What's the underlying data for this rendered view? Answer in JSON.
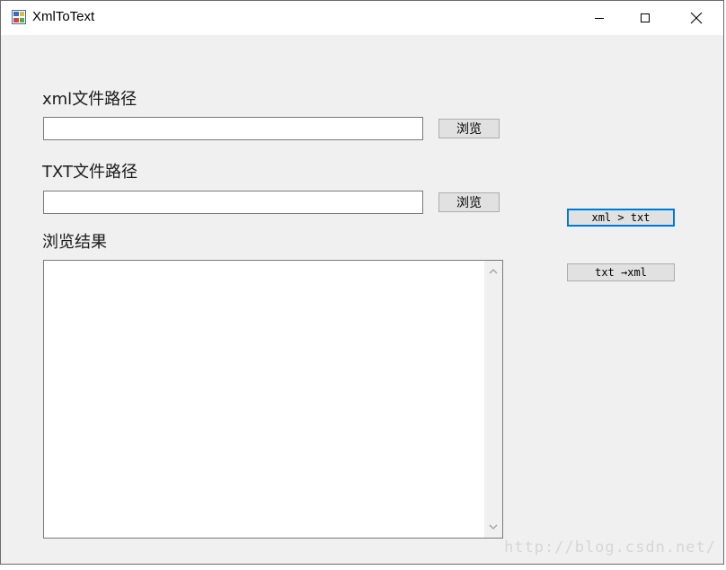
{
  "window": {
    "title": "XmlToText",
    "icon": "windows-form-icon"
  },
  "titlebar_buttons": {
    "minimize": "minimize-icon",
    "maximize": "maximize-icon",
    "close": "close-icon"
  },
  "form": {
    "xml_path_label": "xml文件路径",
    "xml_path_value": "",
    "xml_browse_label": "浏览",
    "txt_path_label": "TXT文件路径",
    "txt_path_value": "",
    "txt_browse_label": "浏览",
    "result_label": "浏览结果",
    "result_value": ""
  },
  "actions": {
    "xml_to_txt_label": "xml > txt",
    "txt_to_xml_label": "txt →xml"
  },
  "watermark": "http://blog.csdn.net/",
  "colors": {
    "focus_border": "#0078d7",
    "window_bg": "#f0f0f0"
  }
}
